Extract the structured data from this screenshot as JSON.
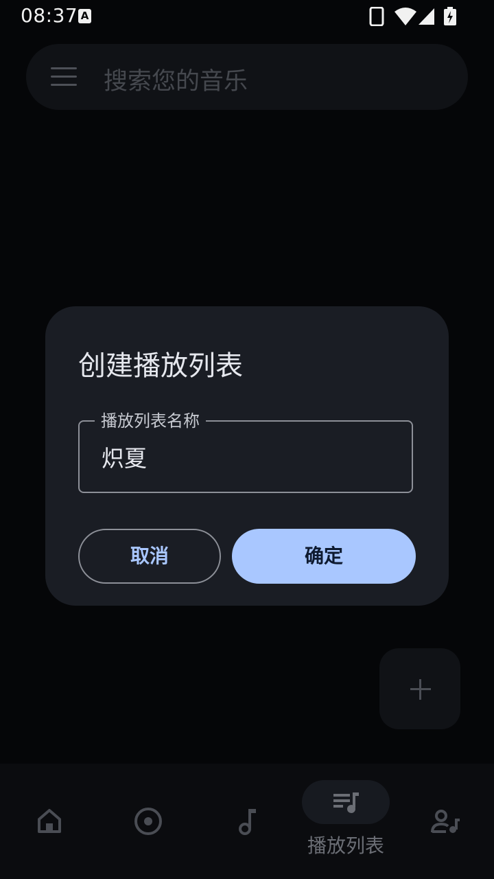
{
  "status_bar": {
    "time": "08:37",
    "notification_icon": "A"
  },
  "search": {
    "placeholder": "搜索您的音乐",
    "menu_icon": "hamburger-menu-icon"
  },
  "dialog": {
    "title": "创建播放列表",
    "field_label": "播放列表名称",
    "field_value": "炽夏",
    "cancel_label": "取消",
    "confirm_label": "确定"
  },
  "fab": {
    "icon": "plus-icon"
  },
  "bottom_nav": {
    "items": [
      {
        "icon": "home-icon"
      },
      {
        "icon": "album-disc-icon"
      },
      {
        "icon": "music-note-icon"
      },
      {
        "icon": "playlist-icon",
        "label": "播放列表",
        "active": true
      },
      {
        "icon": "artist-icon"
      }
    ]
  },
  "colors": {
    "background": "#050608",
    "dialog": "#1a1d24",
    "accent": "#a9c7ff",
    "outline": "#8d9098"
  }
}
